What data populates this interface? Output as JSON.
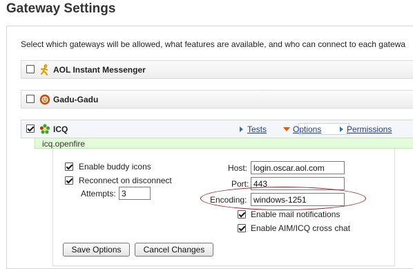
{
  "page": {
    "title": "Gateway Settings",
    "intro": "Select which gateways will be allowed, what features are available, and who can connect to each gatewa"
  },
  "gateways": [
    {
      "name": "AOL Instant Messenger",
      "checked": false,
      "icon": "aim-running-man-icon"
    },
    {
      "name": "Gadu-Gadu",
      "checked": false,
      "icon": "gadu-gadu-sun-icon"
    },
    {
      "name": "ICQ",
      "checked": true,
      "icon": "icq-flower-icon"
    }
  ],
  "icq": {
    "links": {
      "tests": "Tests",
      "options": "Options",
      "permissions": "Permissions"
    },
    "jid": "icq.openfire",
    "options": {
      "enable_buddy_icons": "Enable buddy icons",
      "reconnect": "Reconnect on disconnect",
      "attempts_label": "Attempts:",
      "attempts_value": "3",
      "host_label": "Host:",
      "host_value": "login.oscar.aol.com",
      "port_label": "Port:",
      "port_value": "443",
      "encoding_label": "Encoding:",
      "encoding_value": "windows-1251",
      "mail_notifications": "Enable mail notifications",
      "aim_cross_chat": "Enable AIM/ICQ cross chat",
      "save": "Save Options",
      "cancel": "Cancel Changes"
    }
  },
  "colors": {
    "link": "#1e3e8a",
    "jid_bg": "#e3fadb",
    "highlight_ellipse": "#b0191e",
    "options_arrow": "#e05a10"
  }
}
